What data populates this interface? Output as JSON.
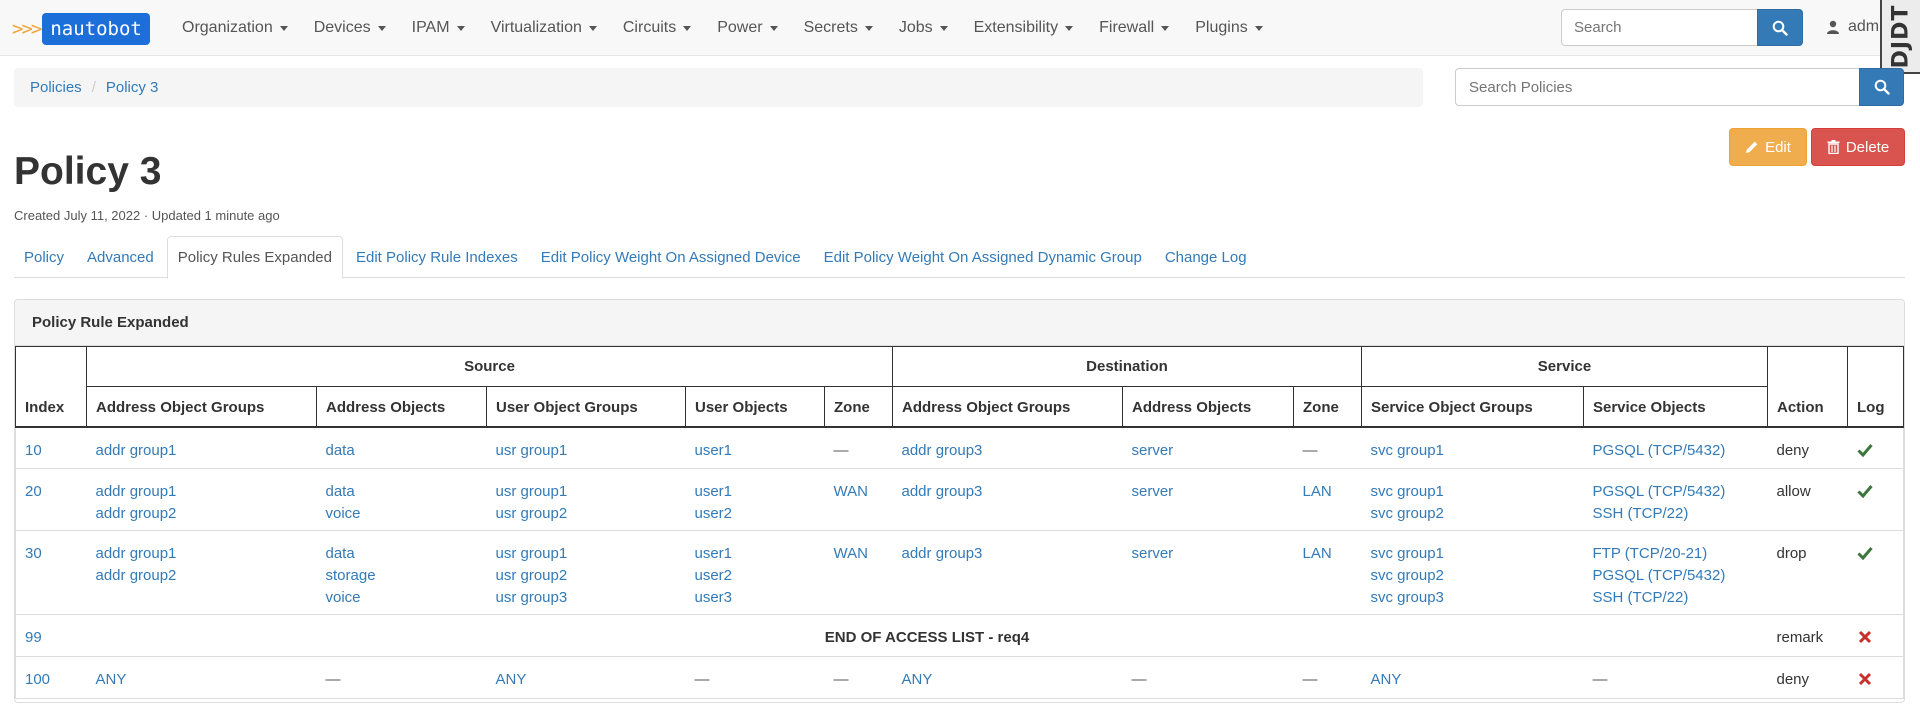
{
  "navbar": {
    "brand": "nautobot",
    "menus": [
      "Organization",
      "Devices",
      "IPAM",
      "Virtualization",
      "Circuits",
      "Power",
      "Secrets",
      "Jobs",
      "Extensibility",
      "Firewall",
      "Plugins"
    ],
    "search_placeholder": "Search",
    "user": "adm",
    "debug_toolbar": "DJDT"
  },
  "breadcrumb": {
    "parent": "Policies",
    "current": "Policy 3"
  },
  "search_policies": {
    "placeholder": "Search Policies"
  },
  "actions": {
    "edit": "Edit",
    "delete": "Delete"
  },
  "page": {
    "title": "Policy 3",
    "meta": "Created July 11, 2022 · Updated 1 minute ago"
  },
  "tabs": [
    "Policy",
    "Advanced",
    "Policy Rules Expanded",
    "Edit Policy Rule Indexes",
    "Edit Policy Weight On Assigned Device",
    "Edit Policy Weight On Assigned Dynamic Group",
    "Change Log"
  ],
  "active_tab": 2,
  "panel": {
    "title": "Policy Rule Expanded",
    "group_headers": {
      "source": "Source",
      "destination": "Destination",
      "service": "Service"
    },
    "columns": {
      "index": "Index",
      "src_addr_groups": "Address Object Groups",
      "src_addr_objects": "Address Objects",
      "src_user_groups": "User Object Groups",
      "src_user_objects": "User Objects",
      "src_zone": "Zone",
      "dst_addr_groups": "Address Object Groups",
      "dst_addr_objects": "Address Objects",
      "dst_zone": "Zone",
      "svc_groups": "Service Object Groups",
      "svc_objects": "Service Objects",
      "action": "Action",
      "log": "Log"
    },
    "rows": [
      {
        "index": "10",
        "src_addr_groups": [
          "addr group1"
        ],
        "src_addr_objects": [
          "data"
        ],
        "src_user_groups": [
          "usr group1"
        ],
        "src_user_objects": [
          "user1"
        ],
        "src_zone": [
          "—"
        ],
        "dst_addr_groups": [
          "addr group3"
        ],
        "dst_addr_objects": [
          "server"
        ],
        "dst_zone": [
          "—"
        ],
        "svc_groups": [
          "svc group1"
        ],
        "svc_objects": [
          "PGSQL (TCP/5432)"
        ],
        "action": "deny",
        "log": true
      },
      {
        "index": "20",
        "src_addr_groups": [
          "addr group1",
          "addr group2"
        ],
        "src_addr_objects": [
          "data",
          "voice"
        ],
        "src_user_groups": [
          "usr group1",
          "usr group2"
        ],
        "src_user_objects": [
          "user1",
          "user2"
        ],
        "src_zone": [
          "WAN"
        ],
        "dst_addr_groups": [
          "addr group3"
        ],
        "dst_addr_objects": [
          "server"
        ],
        "dst_zone": [
          "LAN"
        ],
        "svc_groups": [
          "svc group1",
          "svc group2"
        ],
        "svc_objects": [
          "PGSQL (TCP/5432)",
          "SSH (TCP/22)"
        ],
        "action": "allow",
        "log": true
      },
      {
        "index": "30",
        "src_addr_groups": [
          "addr group1",
          "addr group2"
        ],
        "src_addr_objects": [
          "data",
          "storage",
          "voice"
        ],
        "src_user_groups": [
          "usr group1",
          "usr group2",
          "usr group3"
        ],
        "src_user_objects": [
          "user1",
          "user2",
          "user3"
        ],
        "src_zone": [
          "WAN"
        ],
        "dst_addr_groups": [
          "addr group3"
        ],
        "dst_addr_objects": [
          "server"
        ],
        "dst_zone": [
          "LAN"
        ],
        "svc_groups": [
          "svc group1",
          "svc group2",
          "svc group3"
        ],
        "svc_objects": [
          "FTP (TCP/20-21)",
          "PGSQL (TCP/5432)",
          "SSH (TCP/22)"
        ],
        "action": "drop",
        "log": true
      },
      {
        "index": "99",
        "remark": "END OF ACCESS LIST - req4",
        "action": "remark",
        "log": false
      },
      {
        "index": "100",
        "src_addr_groups": [
          "ANY"
        ],
        "src_addr_objects": [
          "—"
        ],
        "src_user_groups": [
          "ANY"
        ],
        "src_user_objects": [
          "—"
        ],
        "src_zone": [
          "—"
        ],
        "dst_addr_groups": [
          "ANY"
        ],
        "dst_addr_objects": [
          "—"
        ],
        "dst_zone": [
          "—"
        ],
        "svc_groups": [
          "ANY"
        ],
        "svc_objects": [
          "—"
        ],
        "action": "deny",
        "log": false
      }
    ]
  },
  "colors": {
    "link": "#337ab7",
    "check": "#3c763d",
    "cross": "#c9302c",
    "edit": "#f0ad4e",
    "delete": "#d9534f",
    "brand": "#1c6fd8",
    "brand_arrows": "#f0a43a"
  },
  "icons": {
    "search": "search-icon",
    "user": "user-icon",
    "edit": "pencil-icon",
    "delete": "trash-icon",
    "log_on": "check-icon",
    "log_off": "cross-icon"
  }
}
